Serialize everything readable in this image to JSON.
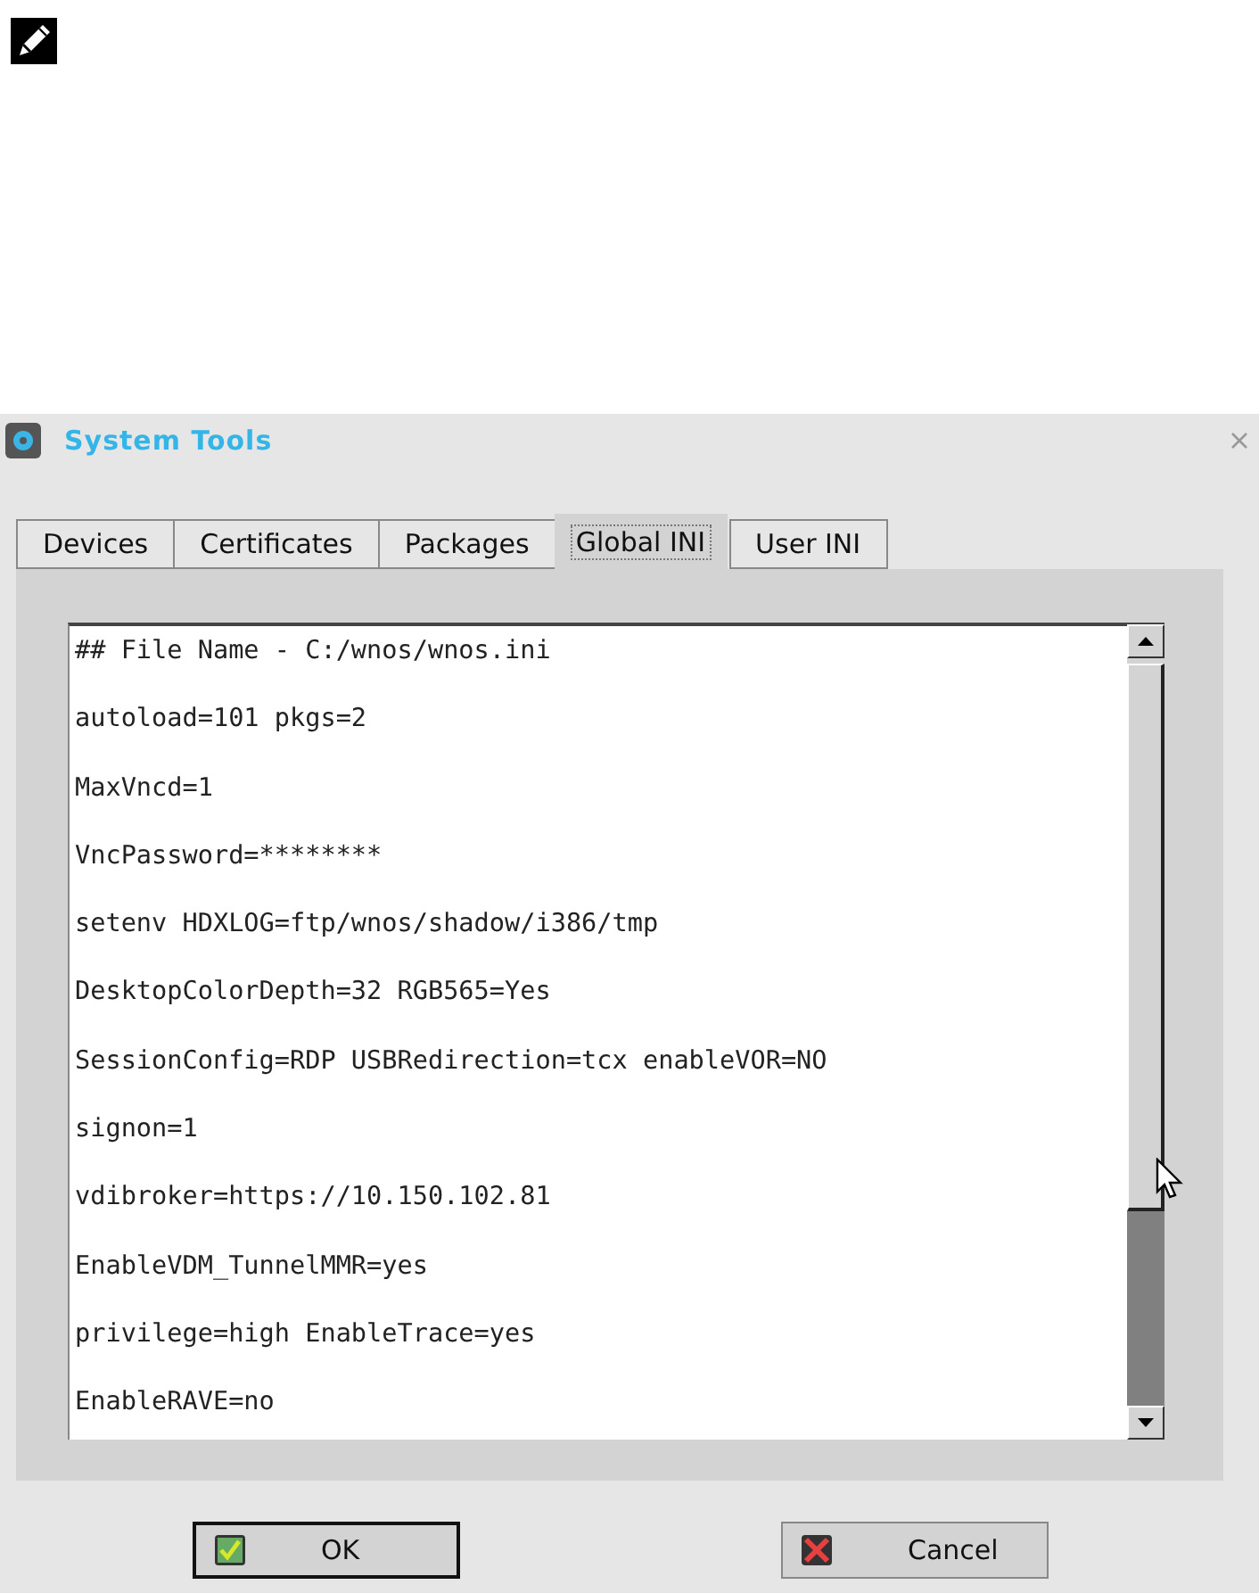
{
  "note": {
    "kind": "pencil"
  },
  "window": {
    "title": "System Tools"
  },
  "tabs": [
    {
      "label": "Devices",
      "selected": false
    },
    {
      "label": "Certificates",
      "selected": false
    },
    {
      "label": "Packages",
      "selected": false
    },
    {
      "label": "Global INI",
      "selected": true
    },
    {
      "label": "User INI",
      "selected": false
    }
  ],
  "editor": {
    "lines": [
      "## File Name - C:/wnos/wnos.ini",
      "autoload=101 pkgs=2",
      "MaxVncd=1",
      "VncPassword=********",
      "setenv HDXLOG=ftp/wnos/shadow/i386/tmp",
      "DesktopColorDepth=32 RGB565=Yes",
      "SessionConfig=RDP USBRedirection=tcx enableVOR=NO",
      "signon=1",
      "vdibroker=https://10.150.102.81",
      "EnableVDM_TunnelMMR=yes",
      "privilege=high EnableTrace=yes",
      "EnableRAVE=no"
    ]
  },
  "buttons": [
    {
      "label": "OK",
      "kind": "ok",
      "default": true
    },
    {
      "label": "Cancel",
      "kind": "cancel",
      "default": false
    }
  ]
}
